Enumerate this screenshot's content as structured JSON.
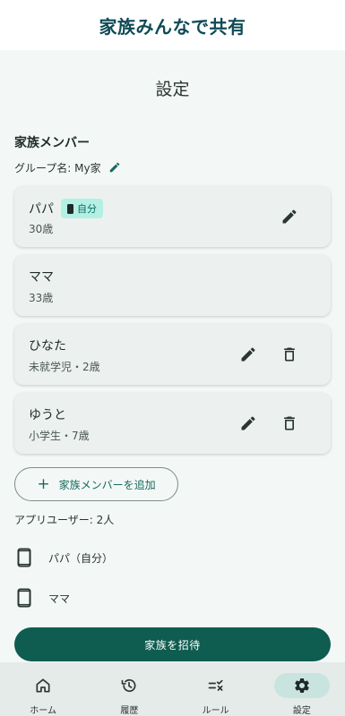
{
  "banner": {
    "title": "家族みんなで共有"
  },
  "page": {
    "title": "設定"
  },
  "family": {
    "section_title": "家族メンバー",
    "group_name": "グループ名: My家",
    "members": [
      {
        "name": "パパ",
        "detail": "30歳",
        "badge": "自分"
      },
      {
        "name": "ママ",
        "detail": "33歳"
      },
      {
        "name": "ひなた",
        "detail": "未就学児・2歳"
      },
      {
        "name": "ゆうと",
        "detail": "小学生・7歳"
      }
    ],
    "add_button": "家族メンバーを追加"
  },
  "app_users": {
    "label": "アプリユーザー: 2人",
    "devices": [
      "パパ（自分）",
      "ママ"
    ]
  },
  "invite_button": "家族を招待",
  "nav": {
    "items": [
      {
        "label": "ホーム",
        "icon": "home-icon"
      },
      {
        "label": "履歴",
        "icon": "history-icon"
      },
      {
        "label": "ルール",
        "icon": "rule-icon"
      },
      {
        "label": "設定",
        "icon": "gear-icon",
        "active": true
      }
    ]
  },
  "colors": {
    "brand": "#0e4a55",
    "accent": "#0f5c50",
    "badge_bg": "#b4efe4",
    "nav_active": "#c9e4de"
  }
}
